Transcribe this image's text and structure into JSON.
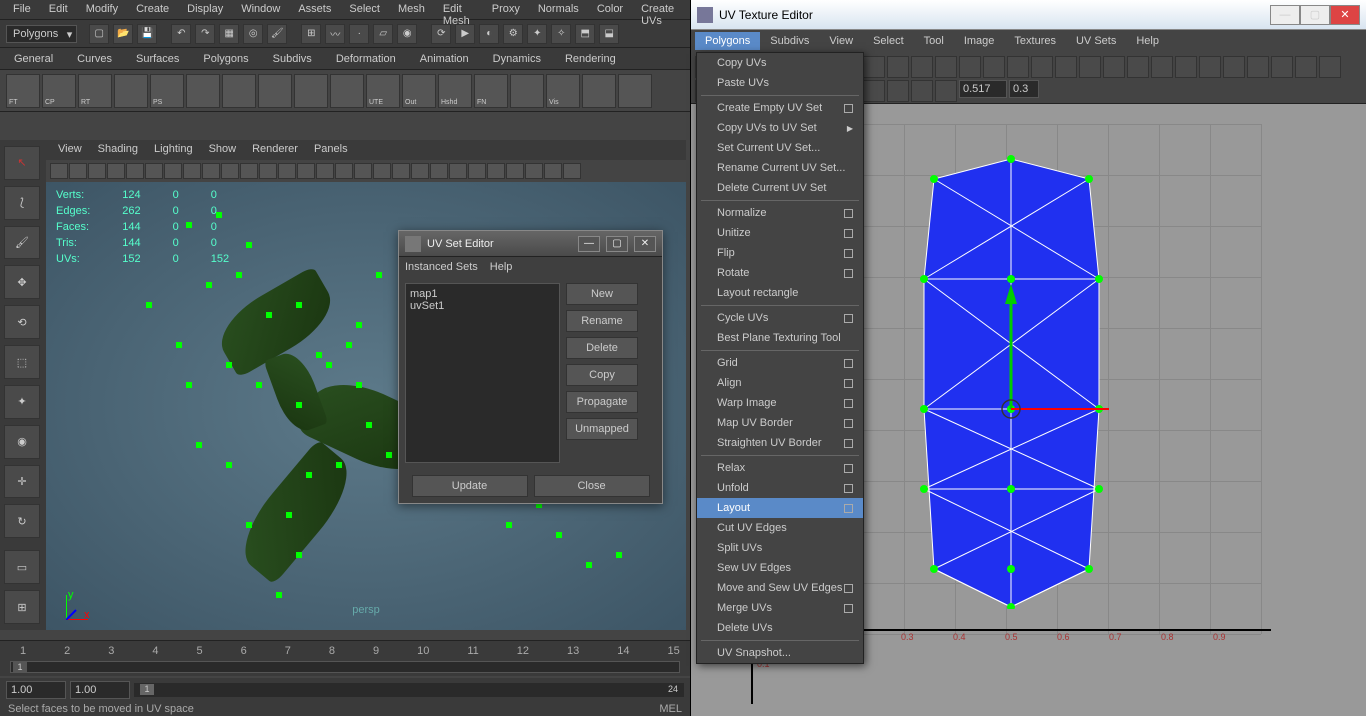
{
  "main_menu": [
    "File",
    "Edit",
    "Modify",
    "Create",
    "Display",
    "Window",
    "Assets",
    "Select",
    "Mesh",
    "Edit Mesh",
    "Proxy",
    "Normals",
    "Color",
    "Create UVs"
  ],
  "mode": "Polygons",
  "shelf_tabs": [
    "General",
    "Curves",
    "Surfaces",
    "Polygons",
    "Subdivs",
    "Deformation",
    "Animation",
    "Dynamics",
    "Rendering"
  ],
  "shelf_icons": [
    "FT",
    "CP",
    "RT",
    "",
    "PS",
    "",
    "",
    "",
    "",
    "",
    "UTE",
    "Out",
    "Hshd",
    "FN",
    "",
    "Vis",
    "",
    ""
  ],
  "vp_menu": [
    "View",
    "Shading",
    "Lighting",
    "Show",
    "Renderer",
    "Panels"
  ],
  "polycount": {
    "rows": [
      {
        "k": "Verts:",
        "a": "124",
        "b": "0",
        "c": "0"
      },
      {
        "k": "Edges:",
        "a": "262",
        "b": "0",
        "c": "0"
      },
      {
        "k": "Faces:",
        "a": "144",
        "b": "0",
        "c": "0"
      },
      {
        "k": "Tris:",
        "a": "144",
        "b": "0",
        "c": "0"
      },
      {
        "k": "UVs:",
        "a": "152",
        "b": "0",
        "c": "152"
      }
    ]
  },
  "persp_label": "persp",
  "timeline_nums": [
    "1",
    "2",
    "3",
    "4",
    "5",
    "6",
    "7",
    "8",
    "9",
    "10",
    "11",
    "12",
    "13",
    "14",
    "15"
  ],
  "timeline_cursor": "1",
  "range": {
    "start": "1.00",
    "end": "1.00",
    "thumb": "1",
    "total": "24"
  },
  "status_text": "Select faces to be moved in UV space",
  "status_mel": "MEL",
  "uvset": {
    "title": "UV Set Editor",
    "menu": [
      "Instanced Sets",
      "Help"
    ],
    "items": [
      "map1",
      "uvSet1"
    ],
    "buttons": [
      "New",
      "Rename",
      "Delete",
      "Copy",
      "Propagate",
      "Unmapped"
    ],
    "bottom": [
      "Update",
      "Close"
    ]
  },
  "uvtex": {
    "title": "UV Texture Editor",
    "menu": [
      "Polygons",
      "Subdivs",
      "View",
      "Select",
      "Tool",
      "Image",
      "Textures",
      "UV Sets",
      "Help"
    ],
    "num1": "0.517",
    "num2": "0.3",
    "ticks": [
      "0.3",
      "0.4",
      "0.5",
      "0.6",
      "0.7",
      "0.8",
      "0.9"
    ],
    "ytick": "0.1"
  },
  "poly_menu": {
    "items": [
      {
        "l": "Copy UVs"
      },
      {
        "l": "Paste UVs"
      },
      {
        "sep": true
      },
      {
        "l": "Create Empty UV Set",
        "box": true
      },
      {
        "l": "Copy UVs to UV Set",
        "arrow": true
      },
      {
        "l": "Set Current UV Set..."
      },
      {
        "l": "Rename Current UV Set..."
      },
      {
        "l": "Delete Current UV Set"
      },
      {
        "sep": true
      },
      {
        "l": "Normalize",
        "box": true
      },
      {
        "l": "Unitize",
        "box": true
      },
      {
        "l": "Flip",
        "box": true
      },
      {
        "l": "Rotate",
        "box": true
      },
      {
        "l": "Layout rectangle"
      },
      {
        "sep": true
      },
      {
        "l": "Cycle UVs",
        "box": true
      },
      {
        "l": "Best Plane Texturing Tool"
      },
      {
        "sep": true
      },
      {
        "l": "Grid",
        "box": true
      },
      {
        "l": "Align",
        "box": true
      },
      {
        "l": "Warp Image",
        "box": true
      },
      {
        "l": "Map UV Border",
        "box": true
      },
      {
        "l": "Straighten UV Border",
        "box": true
      },
      {
        "sep": true
      },
      {
        "l": "Relax",
        "box": true
      },
      {
        "l": "Unfold",
        "box": true
      },
      {
        "l": "Layout",
        "box": true,
        "hl": true
      },
      {
        "l": "Cut UV Edges"
      },
      {
        "l": "Split UVs"
      },
      {
        "l": "Sew UV Edges"
      },
      {
        "l": "Move and Sew UV Edges",
        "box": true
      },
      {
        "l": "Merge UVs",
        "box": true
      },
      {
        "l": "Delete UVs"
      },
      {
        "sep": true
      },
      {
        "l": "UV Snapshot..."
      }
    ]
  }
}
